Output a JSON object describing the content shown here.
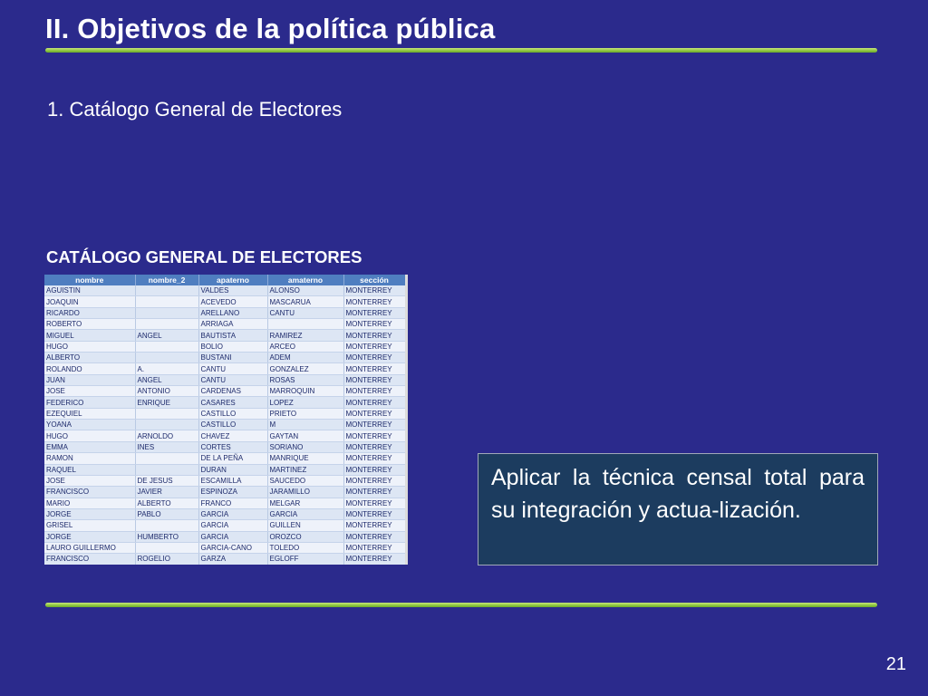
{
  "slide": {
    "title": "II. Objetivos de la política pública",
    "subtitle": "1. Catálogo General de Electores",
    "table_caption": "CATÁLOGO  GENERAL DE ELECTORES",
    "callout": "Aplicar la técnica censal total para su integración y actua-lización.",
    "page_number": "21"
  },
  "colors": {
    "background": "#2b2a8c",
    "rule": "#8cc63f",
    "callout_bg": "#1c3c5f",
    "table_header": "#4f7ec0"
  },
  "table": {
    "columns": [
      "nombre",
      "nombre_2",
      "apaterno",
      "amaterno",
      "sección"
    ],
    "rows": [
      [
        "AGUISTIN",
        "",
        "VALDES",
        "ALONSO",
        "MONTERREY"
      ],
      [
        "JOAQUIN",
        "",
        "ACEVEDO",
        "MASCARUA",
        "MONTERREY"
      ],
      [
        "RICARDO",
        "",
        "ARELLANO",
        "CANTU",
        "MONTERREY"
      ],
      [
        "ROBERTO",
        "",
        "ARRIAGA",
        "",
        "MONTERREY"
      ],
      [
        "MIGUEL",
        "ANGEL",
        "BAUTISTA",
        "RAMIREZ",
        "MONTERREY"
      ],
      [
        "HUGO",
        "",
        "BOLIO",
        "ARCEO",
        "MONTERREY"
      ],
      [
        "ALBERTO",
        "",
        "BUSTANI",
        "ADEM",
        "MONTERREY"
      ],
      [
        "ROLANDO",
        "A.",
        "CANTU",
        "GONZALEZ",
        "MONTERREY"
      ],
      [
        "JUAN",
        "ANGEL",
        "CANTU",
        "ROSAS",
        "MONTERREY"
      ],
      [
        "JOSE",
        "ANTONIO",
        "CARDENAS",
        "MARROQUIN",
        "MONTERREY"
      ],
      [
        "FEDERICO",
        "ENRIQUE",
        "CASARES",
        "LOPEZ",
        "MONTERREY"
      ],
      [
        "EZEQUIEL",
        "",
        "CASTILLO",
        "PRIETO",
        "MONTERREY"
      ],
      [
        "YOANA",
        "",
        "CASTILLO",
        "M",
        "MONTERREY"
      ],
      [
        "HUGO",
        "ARNOLDO",
        "CHAVEZ",
        "GAYTAN",
        "MONTERREY"
      ],
      [
        "EMMA",
        "INES",
        "CORTES",
        "SORIANO",
        "MONTERREY"
      ],
      [
        "RAMON",
        "",
        "DE LA PEÑA",
        "MANRIQUE",
        "MONTERREY"
      ],
      [
        "RAQUEL",
        "",
        "DURAN",
        "MARTINEZ",
        "MONTERREY"
      ],
      [
        "JOSE",
        "DE JESUS",
        "ESCAMILLA",
        "SAUCEDO",
        "MONTERREY"
      ],
      [
        "FRANCISCO",
        "JAVIER",
        "ESPINOZA",
        "JARAMILLO",
        "MONTERREY"
      ],
      [
        "MARIO",
        "ALBERTO",
        "FRANCO",
        "MELGAR",
        "MONTERREY"
      ],
      [
        "JORGE",
        "PABLO",
        "GARCIA",
        "GARCIA",
        "MONTERREY"
      ],
      [
        "GRISEL",
        "",
        "GARCIA",
        "GUILLEN",
        "MONTERREY"
      ],
      [
        "JORGE",
        "HUMBERTO",
        "GARCIA",
        "OROZCO",
        "MONTERREY"
      ],
      [
        "LAURO GUILLERMO",
        "",
        "GARCIA-CANO",
        "TOLEDO",
        "MONTERREY"
      ],
      [
        "FRANCISCO",
        "ROGELIO",
        "GARZA",
        "EGLOFF",
        "MONTERREY"
      ]
    ]
  }
}
